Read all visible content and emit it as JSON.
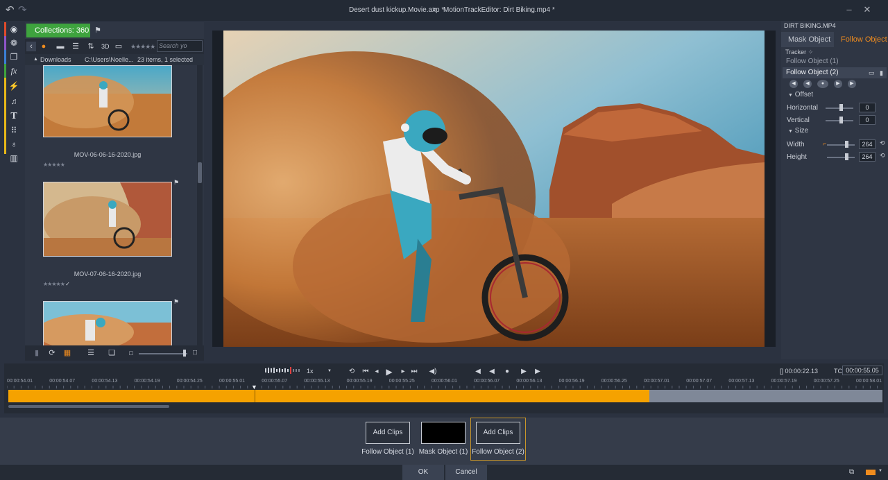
{
  "titlebar": {
    "project": "Desert dust kickup.Movie.axp *",
    "separator": ">",
    "editor": "MotionTrackEditor: Dirt Biking.mp4 *"
  },
  "library": {
    "collections_label": "Collections: 360",
    "view_3d": "3D",
    "search_placeholder": "Search yo",
    "folder_name": "Downloads",
    "folder_path": "C:\\Users\\Noelle...",
    "folder_count": "23 items, 1 selected",
    "thumbnails": [
      {
        "name": "MOV-06-06-16-2020.jpg",
        "stars": "★★★★★",
        "check": ""
      },
      {
        "name": "MOV-07-06-16-2020.jpg",
        "stars": "★★★★★",
        "check": "✓"
      },
      {
        "name": "",
        "stars": "",
        "check": ""
      }
    ]
  },
  "right_panel": {
    "clip_title": "DIRT BIKING.MP4",
    "tab_mask": "Mask Object",
    "tab_follow": "Follow Object",
    "tracker_label": "Tracker",
    "objects": [
      {
        "label": "Follow Object (1)",
        "active": false
      },
      {
        "label": "Follow Object (2)",
        "active": true
      }
    ],
    "offset_label": "Offset",
    "horizontal_label": "Horizontal",
    "horizontal_value": "0",
    "vertical_label": "Vertical",
    "vertical_value": "0",
    "size_label": "Size",
    "width_label": "Width",
    "width_value": "264",
    "height_label": "Height",
    "height_value": "264"
  },
  "timeline": {
    "speed": "1x",
    "duration": "[] 00:00:22.13",
    "tc_label": "TC",
    "timecode": "00:00:55.05",
    "ticks": [
      "00:00:54.01",
      "00:00:54.07",
      "00:00:54.13",
      "00:00:54.19",
      "00:00:54.25",
      "00:00:55.01",
      "00:00:55.07",
      "00:00:55.13",
      "00:00:55.19",
      "00:00:55.25",
      "00:00:56.01",
      "00:00:56.07",
      "00:00:56.13",
      "00:00:56.19",
      "00:00:56.25",
      "00:00:57.01",
      "00:00:57.07",
      "00:00:57.13",
      "00:00:57.19",
      "00:00:57.25",
      "00:00:58.01"
    ],
    "progress": 0.733
  },
  "tray": {
    "slots": [
      {
        "button": "Add Clips",
        "label": "Follow Object (1)"
      },
      {
        "button": "",
        "label": "Mask Object (1)"
      },
      {
        "button": "Add Clips",
        "label": "Follow Object (2)"
      }
    ]
  },
  "footer": {
    "ok": "OK",
    "cancel": "Cancel"
  },
  "colors": {
    "accent": "#f08c1e",
    "timeline_fill": "#f5a200",
    "collections_green": "#3ea33e"
  }
}
